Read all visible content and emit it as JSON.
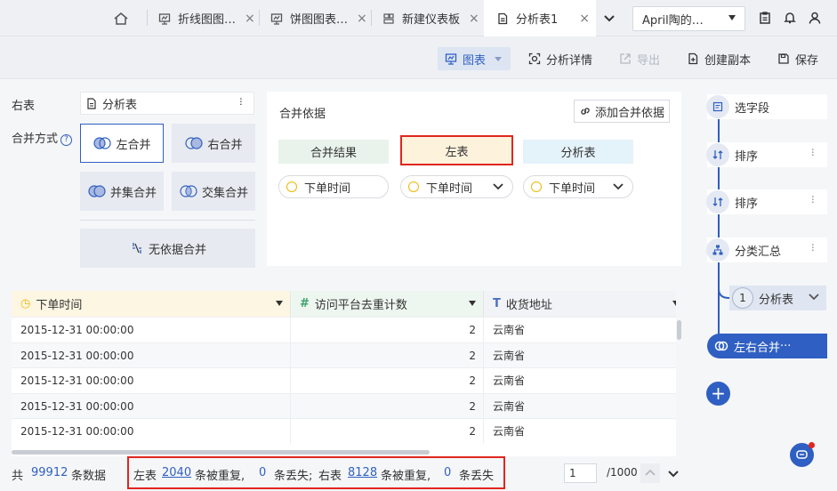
{
  "tabs": [
    {
      "label": "折线图图…",
      "icon": "dashboard-icon"
    },
    {
      "label": "饼图图表…",
      "icon": "dashboard-icon"
    },
    {
      "label": "新建仪表板",
      "icon": "dashboard-grid-icon"
    },
    {
      "label": "分析表1",
      "icon": "document-icon",
      "active": true
    }
  ],
  "user": {
    "name": "April陶的…"
  },
  "toolbar": {
    "chart": "图表",
    "detail": "分析详情",
    "export": "导出",
    "copy": "创建副本",
    "save": "保存"
  },
  "config": {
    "right_table_label": "右表",
    "right_table_value": "分析表",
    "merge_mode_label": "合并方式",
    "help": "?",
    "modes": {
      "left": "左合并",
      "right": "右合并",
      "union": "并集合并",
      "intersect": "交集合并",
      "none": "无依据合并"
    },
    "merge_basis_label": "合并依据",
    "add_basis": "添加合并依据",
    "col_result": "合并结果",
    "col_left": "左表",
    "col_right": "分析表",
    "field_result": "下单时间",
    "field_left": "下单时间",
    "field_right": "下单时间"
  },
  "grid": {
    "headers": [
      {
        "label": "下单时间",
        "type_icon": "◷"
      },
      {
        "label": "访问平台去重计数",
        "type_icon": "#"
      },
      {
        "label": "收货地址",
        "type_icon": "T"
      }
    ],
    "rows": [
      [
        "2015-12-31 00:00:00",
        "2",
        "云南省"
      ],
      [
        "2015-12-31 00:00:00",
        "2",
        "云南省"
      ],
      [
        "2015-12-31 00:00:00",
        "2",
        "云南省"
      ],
      [
        "2015-12-31 00:00:00",
        "2",
        "云南省"
      ],
      [
        "2015-12-31 00:00:00",
        "2",
        "云南省"
      ]
    ]
  },
  "footer": {
    "total_prefix": "共",
    "total": "99912",
    "total_suffix": "条数据",
    "left_label": "左表",
    "left_dup": "2040",
    "dup_text": "条被重复,",
    "left_lost": "0",
    "lost_text_left": "条丢失;",
    "right_label": "右表",
    "right_dup": "8128",
    "dup_text2": "条被重复,",
    "right_lost": "0",
    "lost_text_right": "条丢失",
    "page": "1",
    "page_total": "/1000"
  },
  "pipeline": {
    "steps": [
      {
        "label": "选字段"
      },
      {
        "label": "排序"
      },
      {
        "label": "排序"
      },
      {
        "label": "分类汇总"
      }
    ],
    "sub": {
      "num": "1",
      "label": "分析表"
    },
    "active": "左右合并",
    "add": "+"
  },
  "colors": {
    "accent": "#2f5fc2",
    "highlight": "#e0261f"
  }
}
